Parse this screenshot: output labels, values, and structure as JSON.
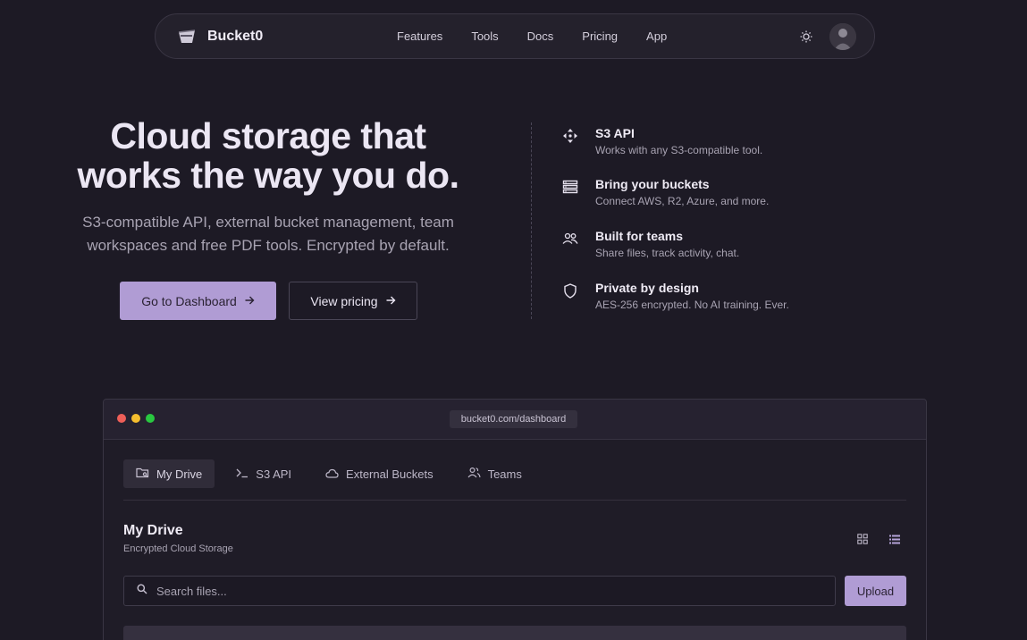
{
  "nav": {
    "brand": "Bucket0",
    "links": [
      "Features",
      "Tools",
      "Docs",
      "Pricing",
      "App"
    ]
  },
  "hero": {
    "title_line1": "Cloud storage that",
    "title_line2": "works the way you do.",
    "subtitle_line1": "S3-compatible API, external bucket management, team",
    "subtitle_line2": "workspaces and free PDF tools. Encrypted by default.",
    "primary_cta": "Go to Dashboard",
    "secondary_cta": "View pricing"
  },
  "features": [
    {
      "icon": "move-arrows-icon",
      "title": "S3 API",
      "desc": "Works with any S3-compatible tool."
    },
    {
      "icon": "server-stack-icon",
      "title": "Bring your buckets",
      "desc": "Connect AWS, R2, Azure, and more."
    },
    {
      "icon": "users-icon",
      "title": "Built for teams",
      "desc": "Share files, track activity, chat."
    },
    {
      "icon": "shield-icon",
      "title": "Private by design",
      "desc": "AES-256 encrypted. No AI training. Ever."
    }
  ],
  "preview": {
    "url": "bucket0.com/dashboard",
    "tabs": [
      {
        "icon": "folder-icon",
        "label": "My Drive",
        "active": true
      },
      {
        "icon": "terminal-icon",
        "label": "S3 API",
        "active": false
      },
      {
        "icon": "cloud-icon",
        "label": "External Buckets",
        "active": false
      },
      {
        "icon": "users-icon",
        "label": "Teams",
        "active": false
      }
    ],
    "title": "My Drive",
    "subtitle": "Encrypted Cloud Storage",
    "search_placeholder": "Search files...",
    "upload_label": "Upload"
  },
  "colors": {
    "background": "#1d1a25",
    "accent": "#b09cd4",
    "dot_red": "#ee5f58",
    "dot_yellow": "#f5be2e",
    "dot_green": "#29c840"
  }
}
